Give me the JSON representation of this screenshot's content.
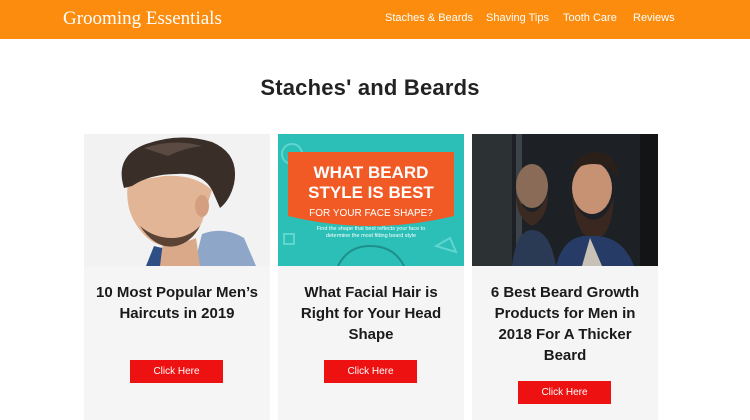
{
  "site": {
    "title": "Grooming Essentials",
    "brand_color": "#fb8c0e"
  },
  "nav": {
    "items": [
      {
        "label": "Staches & Beards"
      },
      {
        "label": "Shaving Tips"
      },
      {
        "label": "Tooth Care"
      },
      {
        "label": "Reviews"
      }
    ]
  },
  "main": {
    "heading": "Staches' and Beards",
    "cards": [
      {
        "title": "10 Most Popular Men’s Haircuts in 2019",
        "button": "Click Here",
        "image": "man-haircut-photo"
      },
      {
        "title": "What Facial Hair is Right for Your Head Shape",
        "button": "Click Here",
        "image": "beard-style-graphic",
        "image_text": {
          "line1": "WHAT BEARD",
          "line2": "STYLE IS BEST",
          "banner": "FOR YOUR FACE SHAPE?",
          "caption1": "Find the shape that best reflects your face to",
          "caption2": "determine the most fitting beard style"
        }
      },
      {
        "title": "6 Best Beard Growth Products for Men in 2018 For A Thicker Beard",
        "button": "Click Here",
        "image": "bearded-man-mirror-photo"
      }
    ],
    "button_color": "#ee1111"
  }
}
